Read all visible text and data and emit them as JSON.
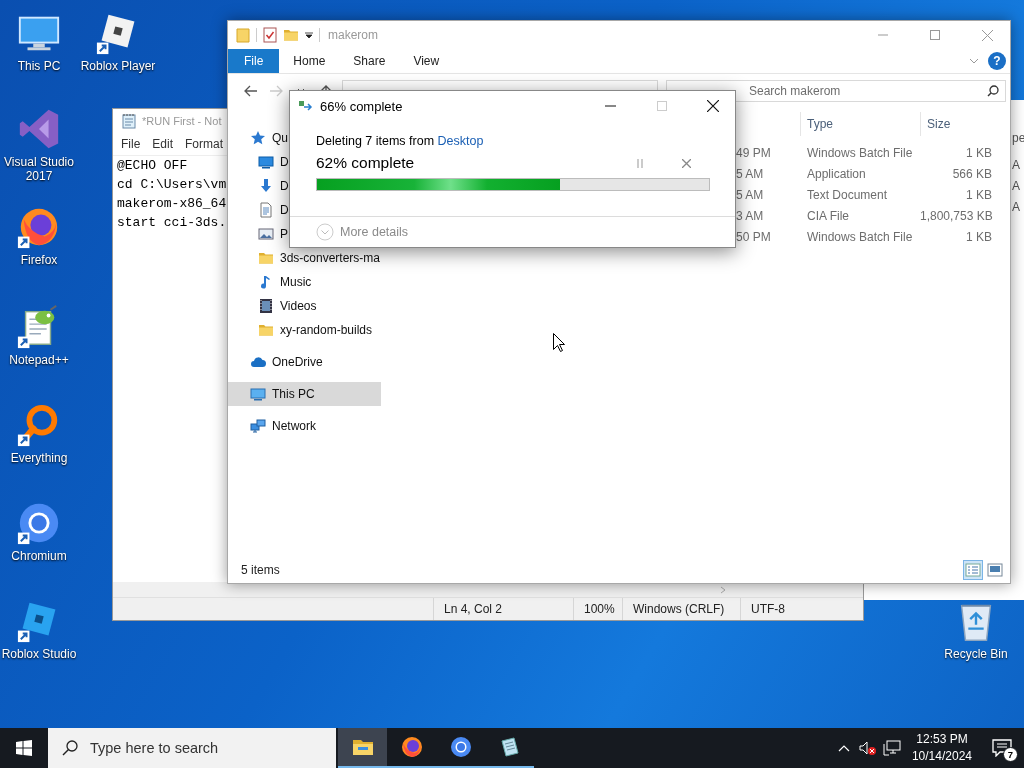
{
  "desktop_icons": [
    {
      "label": "This PC",
      "kind": "pc",
      "shortcut": false
    },
    {
      "label": "Roblox Player",
      "kind": "roblox",
      "shortcut": true
    },
    {
      "label": "Visual Studio 2017",
      "kind": "vs",
      "shortcut": false
    },
    {
      "label": "Firefox",
      "kind": "firefox",
      "shortcut": true
    },
    {
      "label": "Notepad++",
      "kind": "notepadpp",
      "shortcut": true
    },
    {
      "label": "Everything",
      "kind": "everything",
      "shortcut": true
    },
    {
      "label": "Chromium",
      "kind": "chromium",
      "shortcut": true
    },
    {
      "label": "Roblox Studio",
      "kind": "robloxstudio",
      "shortcut": true
    },
    {
      "label": "Recycle Bin",
      "kind": "recycle",
      "shortcut": false
    }
  ],
  "notepad": {
    "title": "*RUN First - Not",
    "menu": [
      "File",
      "Edit",
      "Format"
    ],
    "lines": [
      "@ECHO OFF",
      "cd C:\\Users\\vm",
      "makerom-x86_64",
      "start cci-3ds."
    ],
    "status_bar": [
      "Ln 4, Col 2",
      "100%",
      "Windows (CRLF)",
      "UTF-8"
    ]
  },
  "background_window": {
    "column_header": "pe",
    "cells": [
      "A",
      "A",
      "A"
    ]
  },
  "explorer": {
    "title": "makerom",
    "ribbon_tabs": [
      {
        "label": "File",
        "kind": "menu"
      },
      {
        "label": "Home",
        "kind": "tab"
      },
      {
        "label": "Share",
        "kind": "tab"
      },
      {
        "label": "View",
        "kind": "tab"
      }
    ],
    "help": "?",
    "search": {
      "placeholder": "Search makerom"
    },
    "nav": [
      {
        "label": "Qu",
        "kind": "quick",
        "selected": false,
        "children": [
          {
            "label": "D",
            "kind": "desktop",
            "selected": false
          },
          {
            "label": "D",
            "kind": "downloads",
            "selected": false
          },
          {
            "label": "D",
            "kind": "documents",
            "selected": false
          },
          {
            "label": "P",
            "kind": "pictures",
            "selected": false
          },
          {
            "label": "3ds-converters-ma",
            "kind": "folder",
            "selected": false
          },
          {
            "label": "Music",
            "kind": "music",
            "selected": false
          },
          {
            "label": "Videos",
            "kind": "videos",
            "selected": false
          },
          {
            "label": "xy-random-builds",
            "kind": "folder",
            "selected": false
          }
        ]
      },
      {
        "label": "OneDrive",
        "kind": "onedrive",
        "selected": false
      },
      {
        "label": "This PC",
        "kind": "pc",
        "selected": true
      },
      {
        "label": "Network",
        "kind": "network",
        "selected": false
      }
    ],
    "columns": [
      "Type",
      "Size"
    ],
    "rows": [
      {
        "date": "49 PM",
        "type": "Windows Batch File",
        "size": "1 KB"
      },
      {
        "date": "5 AM",
        "type": "Application",
        "size": "566 KB"
      },
      {
        "date": "5 AM",
        "type": "Text Document",
        "size": "1 KB"
      },
      {
        "date": "3 AM",
        "type": "CIA File",
        "size": "1,800,753 KB"
      },
      {
        "date": "50 PM",
        "type": "Windows Batch File",
        "size": "1 KB"
      }
    ],
    "status": "5 items",
    "view_buttons": [
      {
        "kind": "details",
        "selected": true
      },
      {
        "kind": "large_icons",
        "selected": false
      }
    ]
  },
  "dialog": {
    "title": "66% complete",
    "message": "Deleting 7 items from",
    "source": "Desktop",
    "progress_text": "62% complete",
    "level": 0.62,
    "more": "More details"
  },
  "taskbar": {
    "search": {
      "placeholder": "Type here to search"
    },
    "apps": [
      {
        "kind": "explorer",
        "active": true
      },
      {
        "kind": "firefox",
        "active": false
      },
      {
        "kind": "chromium",
        "active": false
      },
      {
        "kind": "notepad",
        "active": false
      }
    ],
    "volume_muted": true,
    "time": "12:53 PM",
    "date": "10/14/2024",
    "notification_count": "7"
  }
}
